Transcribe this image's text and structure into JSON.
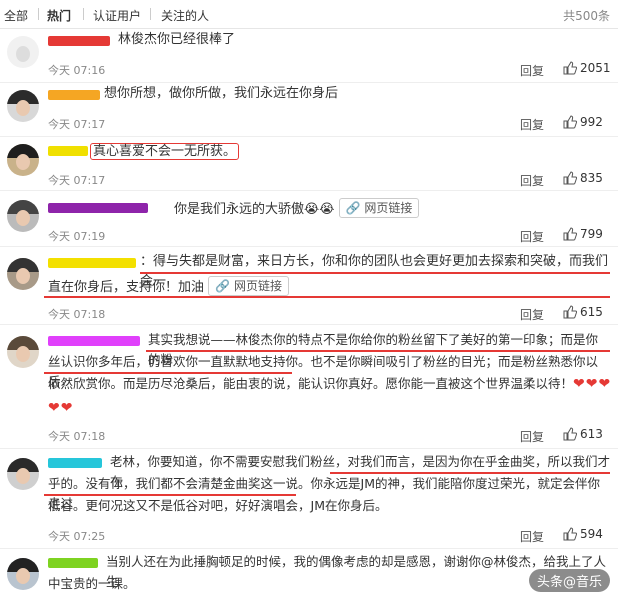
{
  "tabs": [
    {
      "label": "全部"
    },
    {
      "label": "热门"
    },
    {
      "label": "认证用户"
    },
    {
      "label": "关注的人"
    }
  ],
  "total_label": "共500条",
  "reply_label": "回复",
  "weblink_label": "网页链接",
  "icons": {
    "like": "thumbs-up-icon",
    "link": "link-icon"
  },
  "colors": {
    "highlight": "#e53935"
  },
  "comments": [
    {
      "text": "林俊杰你已经很棒了",
      "time": "今天 07:16",
      "likes": "2051"
    },
    {
      "text": "想你所想，做你所做，我们永远在你身后",
      "time": "今天 07:17",
      "likes": "992"
    },
    {
      "text": "真心喜爱不会一无所获。",
      "time": "今天 07:17",
      "likes": "835"
    },
    {
      "text": "你是我们永远的大骄傲😭😭",
      "time": "今天 07:19",
      "likes": "799"
    },
    {
      "text_a": "：得与失都是财富，来日方长，你和你的团队也会更好更加去探索和突破，而我们会一",
      "text_b": "直在你身后，支持你！加油",
      "time": "今天 07:18",
      "likes": "615"
    },
    {
      "text_a": "其实我想说——林俊杰你的特点不是你给你的粉丝留下了美好的第一印象；而是你的粉",
      "text_b": "丝认识你多年后，仍喜欢你一直默默地支持你。也不是你瞬间吸引了粉丝的目光；而是粉丝熟悉你以后，",
      "text_c": "依然欣赏你。而是历尽沧桑后，能由衷的说，能认识你真好。愿你能一直被这个世界温柔以待！",
      "hearts": "❤❤❤",
      "hearts2": "❤❤",
      "time": "今天 07:18",
      "likes": "613"
    },
    {
      "text_a": "老林，你要知道，你不需要安慰我们粉丝，对我们而言，是因为你在乎金曲奖，所以我们才在",
      "text_b": "乎的。没有你，我们都不会清楚金曲奖这一说。你永远是JM的神，我们能陪你度过荣光，就定会伴你走过",
      "text_c": "低谷。更何况这又不是低谷对吧，好好演唱会，JM在你身后。",
      "time": "今天 07:25",
      "likes": "594"
    },
    {
      "text_a": "当别人还在为此捶胸顿足的时候，我的偶像考虑的却是感恩，谢谢你@林俊杰，给我上了人生",
      "text_b": "中宝贵的一课。"
    }
  ],
  "watermark": "头条@音乐"
}
